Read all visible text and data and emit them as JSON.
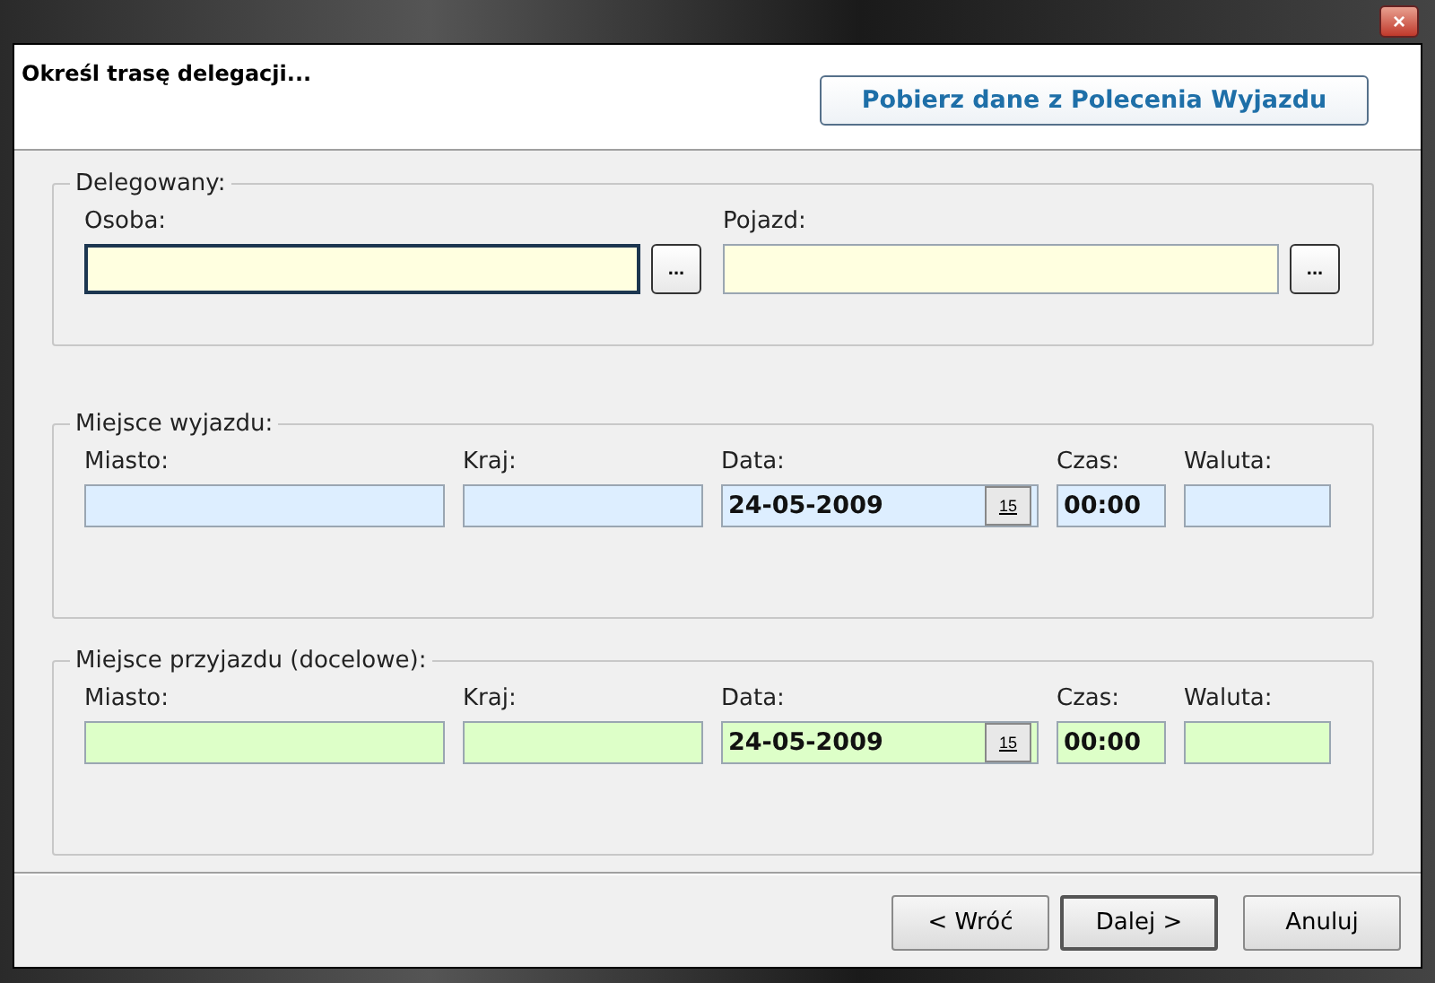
{
  "window": {
    "close": "×"
  },
  "header": {
    "title": "Określ trasę delegacji...",
    "fetch_button": "Pobierz dane z Polecenia Wyjazdu"
  },
  "groups": [
    {
      "legend": "Delegowany:",
      "kind": "person",
      "color": "#ffffe0",
      "fields": [
        {
          "label": "Osoba:",
          "kind": "lookup",
          "focused": true,
          "button": "..."
        },
        {
          "label": "Pojazd:",
          "kind": "lookup",
          "focused": false,
          "button": "..."
        }
      ]
    },
    {
      "legend": "Miejsce wyjazdu:",
      "kind": "route",
      "color": "#ddeeff",
      "fields": [
        {
          "label": "Miasto:",
          "kind": "text"
        },
        {
          "label": "Kraj:",
          "kind": "text"
        },
        {
          "label": "Data:",
          "kind": "date",
          "value": "24-05-2009",
          "button": "15"
        },
        {
          "label": "Czas:",
          "kind": "time",
          "value": "00:00"
        },
        {
          "label": "Waluta:",
          "kind": "text"
        }
      ]
    },
    {
      "legend": "Miejsce przyjazdu (docelowe):",
      "kind": "route",
      "color": "#ddffc8",
      "fields": [
        {
          "label": "Miasto:",
          "kind": "text"
        },
        {
          "label": "Kraj:",
          "kind": "text"
        },
        {
          "label": "Data:",
          "kind": "date",
          "value": "24-05-2009",
          "button": "15"
        },
        {
          "label": "Czas:",
          "kind": "time",
          "value": "00:00"
        },
        {
          "label": "Waluta:",
          "kind": "text"
        }
      ]
    }
  ],
  "buttons": [
    {
      "label": "< Wróć",
      "selected": false
    },
    {
      "label": "Dalej >",
      "selected": true
    },
    {
      "label": "Anuluj",
      "selected": false
    }
  ]
}
